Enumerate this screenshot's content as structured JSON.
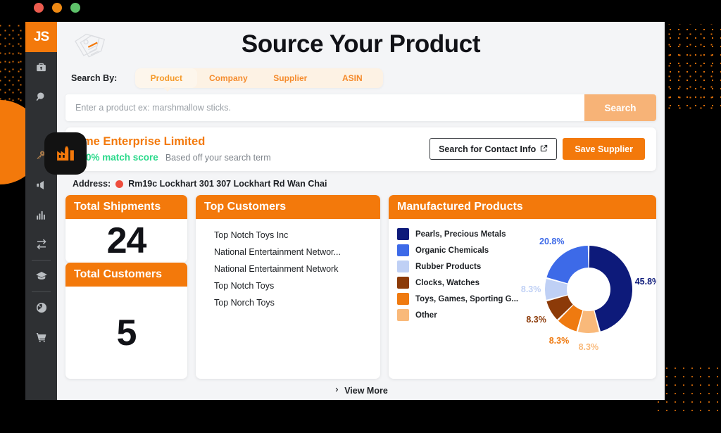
{
  "window_controls": {
    "close": "close",
    "minimize": "minimize",
    "maximize": "maximize"
  },
  "colors": {
    "accent_orange": "#f3790b",
    "accent_orange_muted": "#f7b377",
    "match_green": "#29d98a",
    "sidebar_bg": "#2e3033",
    "app_bg": "#f4f5f7",
    "pin_red": "#ee4d3d"
  },
  "sidebar": {
    "logo": "JS",
    "items": [
      {
        "name": "sidebar-item-toolbox",
        "icon": "briefcase-icon",
        "active": false
      },
      {
        "name": "sidebar-item-search",
        "icon": "magnifier-icon",
        "active": false
      },
      {
        "name": "sidebar-item-supplier",
        "icon": "factory-icon",
        "active": true
      },
      {
        "name": "sidebar-item-keyword",
        "icon": "key-icon",
        "active": false
      },
      {
        "name": "sidebar-item-promotions",
        "icon": "megaphone-icon",
        "active": false
      },
      {
        "name": "sidebar-item-analytics",
        "icon": "bar-chart-icon",
        "active": false
      },
      {
        "name": "sidebar-item-refunds",
        "icon": "refresh-icon",
        "active": false
      },
      {
        "name": "sidebar-item-academy",
        "icon": "graduation-cap-icon",
        "active": false
      },
      {
        "name": "sidebar-item-global",
        "icon": "globe-icon",
        "active": false
      },
      {
        "name": "sidebar-item-cart",
        "icon": "shopping-cart-icon",
        "active": false
      }
    ]
  },
  "header": {
    "title": "Source Your Product",
    "tag_icon": "price-tag-icon"
  },
  "search": {
    "search_by_label": "Search By:",
    "tabs": [
      {
        "label": "Product",
        "active": true
      },
      {
        "label": "Company",
        "active": false
      },
      {
        "label": "Supplier",
        "active": false
      },
      {
        "label": "ASIN",
        "active": false
      }
    ],
    "placeholder": "Enter a product ex: marshmallow sticks.",
    "value": "",
    "button_label": "Search"
  },
  "supplier": {
    "name": "Sme Enterprise Limited",
    "match_score": "100% match score",
    "match_note": "Based off your search term",
    "contact_button": "Search for Contact Info",
    "contact_button_icon": "external-link-icon",
    "save_button": "Save Supplier",
    "address_label": "Address:",
    "address_icon": "map-pin-icon",
    "address_value": "Rm19c Lockhart 301 307 Lockhart Rd Wan Chai"
  },
  "stats": {
    "total_shipments_label": "Total Shipments",
    "total_shipments_value": "24",
    "total_customers_label": "Total Customers",
    "total_customers_value": "5"
  },
  "top_customers": {
    "title": "Top Customers",
    "items": [
      "Top Notch Toys Inc",
      "National Entertainment Networ...",
      "National Entertainment Network",
      "Top Notch Toys",
      "Top Norch Toys"
    ]
  },
  "footer": {
    "view_more_label": "View More",
    "view_more_icon": "chevron-right-icon"
  },
  "chart_data": {
    "type": "pie",
    "title": "Manufactured Products",
    "donut": true,
    "legend_position": "left",
    "categories": [
      "Pearls, Precious Metals",
      "Organic Chemicals",
      "Rubber Products",
      "Clocks, Watches",
      "Toys, Games, Sporting G...",
      "Other"
    ],
    "values": [
      45.8,
      20.8,
      8.3,
      8.3,
      8.3,
      8.3
    ],
    "value_labels": [
      "45.8%",
      "20.8%",
      "8.3%",
      "8.3%",
      "8.3%",
      "8.3%"
    ],
    "colors": [
      "#0d1a7a",
      "#3d6ae8",
      "#bfd0f5",
      "#8c3a08",
      "#ef7a10",
      "#f9b97a"
    ],
    "unit": "%",
    "slice_order_clockwise_from_top": [
      "Pearls, Precious Metals",
      "Other",
      "Toys, Games, Sporting G...",
      "Clocks, Watches",
      "Rubber Products",
      "Organic Chemicals"
    ]
  }
}
